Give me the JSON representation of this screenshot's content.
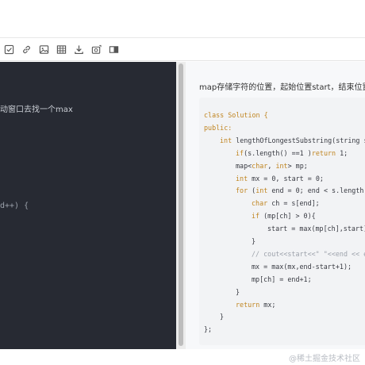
{
  "toolbar": {
    "items": [
      {
        "name": "task-checkbox-icon"
      },
      {
        "name": "link-icon"
      },
      {
        "name": "image-icon"
      },
      {
        "name": "table-icon"
      },
      {
        "name": "download-icon"
      },
      {
        "name": "screenshot-icon"
      },
      {
        "name": "preview-toggle-icon"
      }
    ]
  },
  "editor": {
    "line1": "动窗口去找一个max",
    "line2": "d++) {"
  },
  "preview": {
    "paragraph": "map存储字符的位置，起始位置start，结束位置end",
    "code": [
      {
        "indent": 0,
        "parts": [
          {
            "t": "class Solution {",
            "c": "kw"
          }
        ]
      },
      {
        "indent": 0,
        "parts": [
          {
            "t": "public:",
            "c": "kw"
          }
        ]
      },
      {
        "indent": 1,
        "parts": [
          {
            "t": "int ",
            "c": "kw"
          },
          {
            "t": "lengthOfLongestSubstring(string s) {",
            "c": ""
          }
        ]
      },
      {
        "indent": 2,
        "parts": [
          {
            "t": "if",
            "c": "kw"
          },
          {
            "t": "(s.length() ==1 )",
            "c": ""
          },
          {
            "t": "return ",
            "c": "kw"
          },
          {
            "t": "1;",
            "c": ""
          }
        ]
      },
      {
        "indent": 2,
        "parts": [
          {
            "t": "map<",
            "c": ""
          },
          {
            "t": "char",
            "c": "kw"
          },
          {
            "t": ", ",
            "c": ""
          },
          {
            "t": "int",
            "c": "kw"
          },
          {
            "t": "> mp;",
            "c": ""
          }
        ]
      },
      {
        "indent": 2,
        "parts": [
          {
            "t": "int ",
            "c": "kw"
          },
          {
            "t": "mx = 0, start = 0;",
            "c": ""
          }
        ]
      },
      {
        "indent": 2,
        "parts": [
          {
            "t": "for ",
            "c": "kw"
          },
          {
            "t": "(",
            "c": ""
          },
          {
            "t": "int ",
            "c": "kw"
          },
          {
            "t": "end = 0; end < s.length(); end++) {",
            "c": ""
          }
        ]
      },
      {
        "indent": 3,
        "parts": [
          {
            "t": "char ",
            "c": "kw"
          },
          {
            "t": "ch = s[end];",
            "c": ""
          }
        ]
      },
      {
        "indent": 3,
        "parts": [
          {
            "t": "if ",
            "c": "kw"
          },
          {
            "t": "(mp[ch] > 0){",
            "c": ""
          }
        ]
      },
      {
        "indent": 4,
        "parts": [
          {
            "t": "start = max(mp[ch],start);",
            "c": ""
          }
        ]
      },
      {
        "indent": 3,
        "parts": [
          {
            "t": "}",
            "c": ""
          }
        ]
      },
      {
        "indent": 3,
        "parts": [
          {
            "t": "// cout<<start<<\" \"<<end << endl;",
            "c": "cm"
          }
        ]
      },
      {
        "indent": 3,
        "parts": [
          {
            "t": "mx = max(mx,end-start+1);",
            "c": ""
          }
        ]
      },
      {
        "indent": 3,
        "parts": [
          {
            "t": "mp[ch] = end+1;",
            "c": ""
          }
        ]
      },
      {
        "indent": 2,
        "parts": [
          {
            "t": "}",
            "c": ""
          }
        ]
      },
      {
        "indent": 2,
        "parts": [
          {
            "t": "return ",
            "c": "kw"
          },
          {
            "t": "mx;",
            "c": ""
          }
        ]
      },
      {
        "indent": 1,
        "parts": [
          {
            "t": "}",
            "c": ""
          }
        ]
      },
      {
        "indent": 0,
        "parts": [
          {
            "t": "};",
            "c": ""
          }
        ]
      }
    ]
  },
  "footer": {
    "watermark": "@稀土掘金技术社区"
  },
  "colors": {
    "editor_bg": "#272a33",
    "preview_bg": "#f7f8fa",
    "code_bg": "#f2f3f5",
    "keyword": "#c08521",
    "comment": "#9da2ab"
  }
}
